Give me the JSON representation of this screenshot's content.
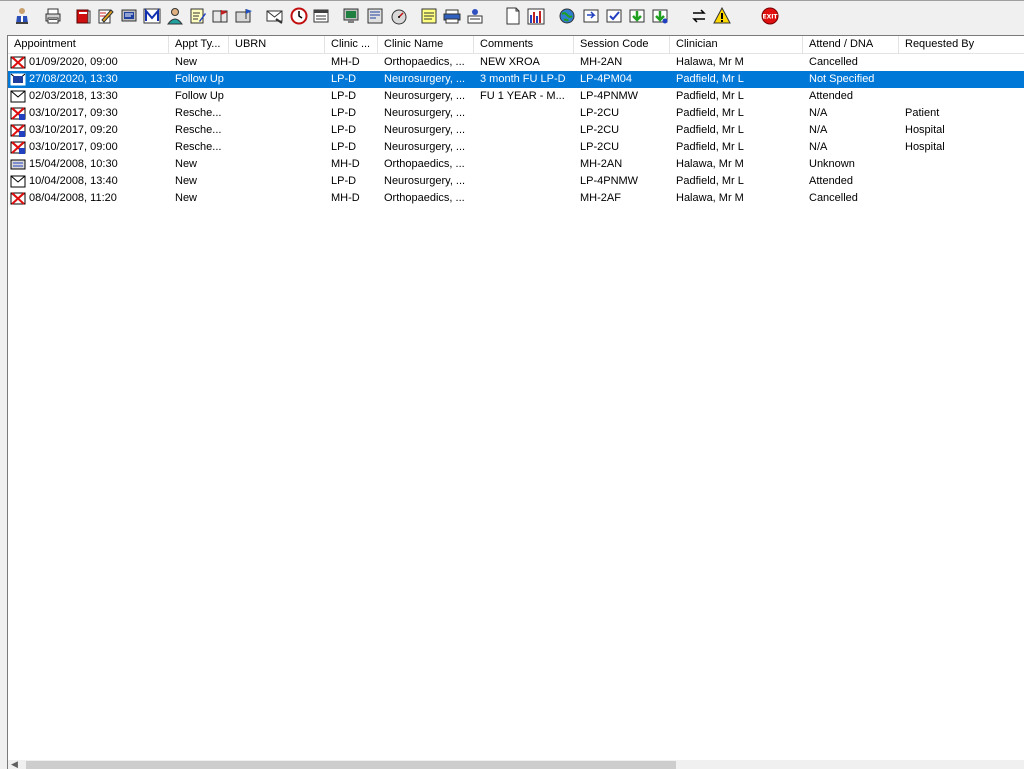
{
  "toolbar": {
    "buttons": [
      {
        "icon": "patient-user-icon"
      },
      {
        "icon": "printer-icon"
      },
      {
        "icon": "red-book-icon"
      },
      {
        "icon": "edit-notes-icon"
      },
      {
        "icon": "screen-view-icon"
      },
      {
        "icon": "letter-m-icon"
      },
      {
        "icon": "doctor-icon"
      },
      {
        "icon": "pen-note-icon"
      },
      {
        "icon": "flag-note-icon"
      },
      {
        "icon": "flag-folder-icon"
      },
      {
        "icon": "envelope-icon"
      },
      {
        "icon": "clock-icon"
      },
      {
        "icon": "list-window-icon"
      },
      {
        "icon": "monitor-icon"
      },
      {
        "icon": "form-icon"
      },
      {
        "icon": "timer-icon"
      },
      {
        "icon": "yellow-note-icon"
      },
      {
        "icon": "printer-stack-icon"
      },
      {
        "icon": "person-form-icon"
      },
      {
        "icon": "document-icon"
      },
      {
        "icon": "bar-chart-icon"
      },
      {
        "icon": "globe-icon"
      },
      {
        "icon": "arrow-folder-icon"
      },
      {
        "icon": "check-folder-icon"
      },
      {
        "icon": "green-arrow-folder-icon"
      },
      {
        "icon": "green-arrow-folder-2-icon"
      },
      {
        "icon": "swap-arrows-icon"
      },
      {
        "icon": "warning-icon"
      },
      {
        "icon": "exit-icon",
        "label": "EXIT"
      }
    ]
  },
  "table": {
    "columns": [
      "Appointment",
      "Appt Ty...",
      "UBRN",
      "Clinic ...",
      "Clinic Name",
      "Comments",
      "Session Code",
      "Clinician",
      "Attend / DNA",
      "Requested By"
    ],
    "rows": [
      {
        "icon": "cancelled-envelope-icon",
        "cells": [
          "01/09/2020, 09:00",
          "New",
          "",
          "MH-D",
          "Orthopaedics, ...",
          "NEW XROA",
          "MH-2AN",
          "Halawa, Mr M",
          "Cancelled",
          ""
        ]
      },
      {
        "icon": "not-specified-envelope-icon",
        "cells": [
          "27/08/2020, 13:30",
          "Follow Up",
          "",
          "LP-D",
          "Neurosurgery, ...",
          "3 month FU LP-D",
          "LP-4PM04",
          "Padfield, Mr L",
          "Not Specified",
          ""
        ],
        "selected": true
      },
      {
        "icon": "attended-envelope-icon",
        "cells": [
          "02/03/2018, 13:30",
          "Follow Up",
          "",
          "LP-D",
          "Neurosurgery, ...",
          "FU 1 YEAR - M...",
          "LP-4PNMW",
          "Padfield, Mr L",
          "Attended",
          ""
        ]
      },
      {
        "icon": "rescheduled-envelope-icon",
        "cells": [
          "03/10/2017, 09:30",
          "Resche...",
          "",
          "LP-D",
          "Neurosurgery, ...",
          "",
          "LP-2CU",
          "Padfield, Mr L",
          "N/A",
          "Patient"
        ]
      },
      {
        "icon": "rescheduled-envelope-icon",
        "cells": [
          "03/10/2017, 09:20",
          "Resche...",
          "",
          "LP-D",
          "Neurosurgery, ...",
          "",
          "LP-2CU",
          "Padfield, Mr L",
          "N/A",
          "Hospital"
        ]
      },
      {
        "icon": "rescheduled-envelope-icon",
        "cells": [
          "03/10/2017, 09:00",
          "Resche...",
          "",
          "LP-D",
          "Neurosurgery, ...",
          "",
          "LP-2CU",
          "Padfield, Mr L",
          "N/A",
          "Hospital"
        ]
      },
      {
        "icon": "unknown-keyboard-icon",
        "cells": [
          "15/04/2008, 10:30",
          "New",
          "",
          "MH-D",
          "Orthopaedics, ...",
          "",
          "MH-2AN",
          "Halawa, Mr M",
          "Unknown",
          ""
        ]
      },
      {
        "icon": "attended-envelope-icon",
        "cells": [
          "10/04/2008, 13:40",
          "New",
          "",
          "LP-D",
          "Neurosurgery, ...",
          "",
          "LP-4PNMW",
          "Padfield, Mr L",
          "Attended",
          ""
        ]
      },
      {
        "icon": "cancelled-envelope-icon",
        "cells": [
          "08/04/2008, 11:20",
          "New",
          "",
          "MH-D",
          "Orthopaedics, ...",
          "",
          "MH-2AF",
          "Halawa, Mr M",
          "Cancelled",
          ""
        ]
      }
    ]
  },
  "colors": {
    "selection": "#0078d7",
    "background": "#f0f0f0",
    "list_background": "#ffffff"
  }
}
